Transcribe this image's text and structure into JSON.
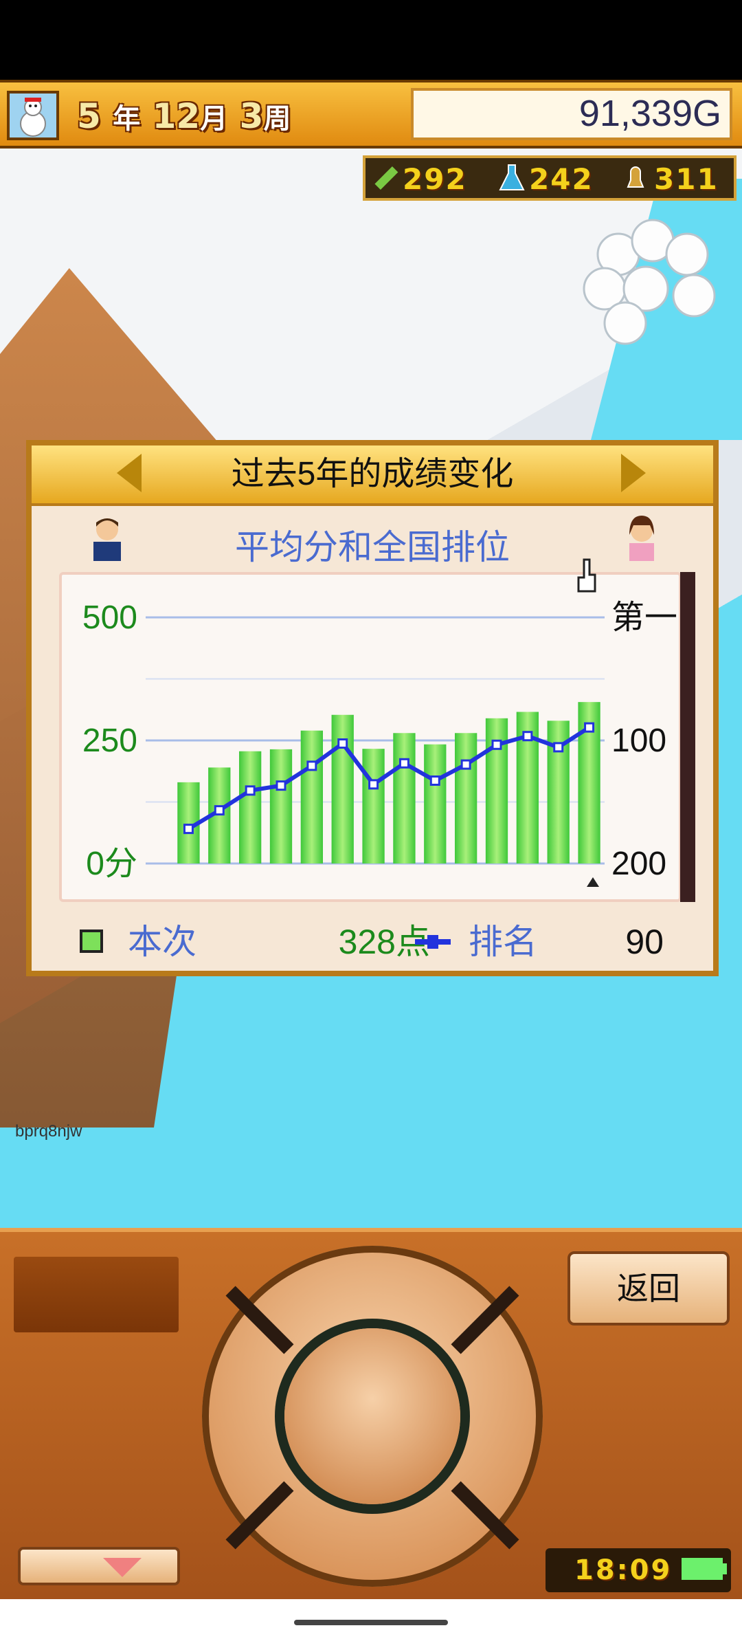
{
  "header": {
    "year_value": "5",
    "year_unit": "年",
    "month_value": "12",
    "month_unit": "月",
    "week_value": "3",
    "week_unit": "周",
    "money": "91,339G"
  },
  "resources": {
    "items": [
      {
        "icon": "pencil-icon",
        "value": "292"
      },
      {
        "icon": "flask-icon",
        "value": "242"
      },
      {
        "icon": "bell-icon",
        "value": "311"
      }
    ]
  },
  "dialog": {
    "title": "过去5年的成绩变化",
    "subtitle": "平均分和全国排位",
    "legend_current_label": "本次",
    "legend_score": "328点",
    "legend_rank_label": "排名",
    "legend_rank_value": "90"
  },
  "chart_data": {
    "type": "bar",
    "title": "平均分和全国排位",
    "left_axis": {
      "ticks": [
        "500",
        "250",
        "0分"
      ],
      "ylim": [
        0,
        500
      ]
    },
    "right_axis": {
      "ticks": [
        "第一",
        "100",
        "200"
      ],
      "ylim": [
        1,
        200
      ],
      "inverted": true
    },
    "grid": true,
    "series": [
      {
        "name": "本次",
        "type": "bar",
        "color": "#5fd84a",
        "values": [
          165,
          195,
          228,
          232,
          270,
          302,
          233,
          265,
          242,
          265,
          295,
          308,
          290,
          328
        ]
      },
      {
        "name": "排名",
        "type": "line",
        "color": "#2233dd",
        "axis": "right",
        "values": [
          172,
          157,
          141,
          137,
          121,
          103,
          136,
          119,
          133,
          120,
          104,
          97,
          106,
          90
        ]
      }
    ]
  },
  "controller": {
    "back_label": "返回",
    "clock": "18:09"
  },
  "watermark": "bprq8njw",
  "colors": {
    "accent": "#e6a820",
    "frame": "#b87a1a",
    "subtitle_blue": "#4a6bd0",
    "score_green": "#1c8a1c"
  }
}
